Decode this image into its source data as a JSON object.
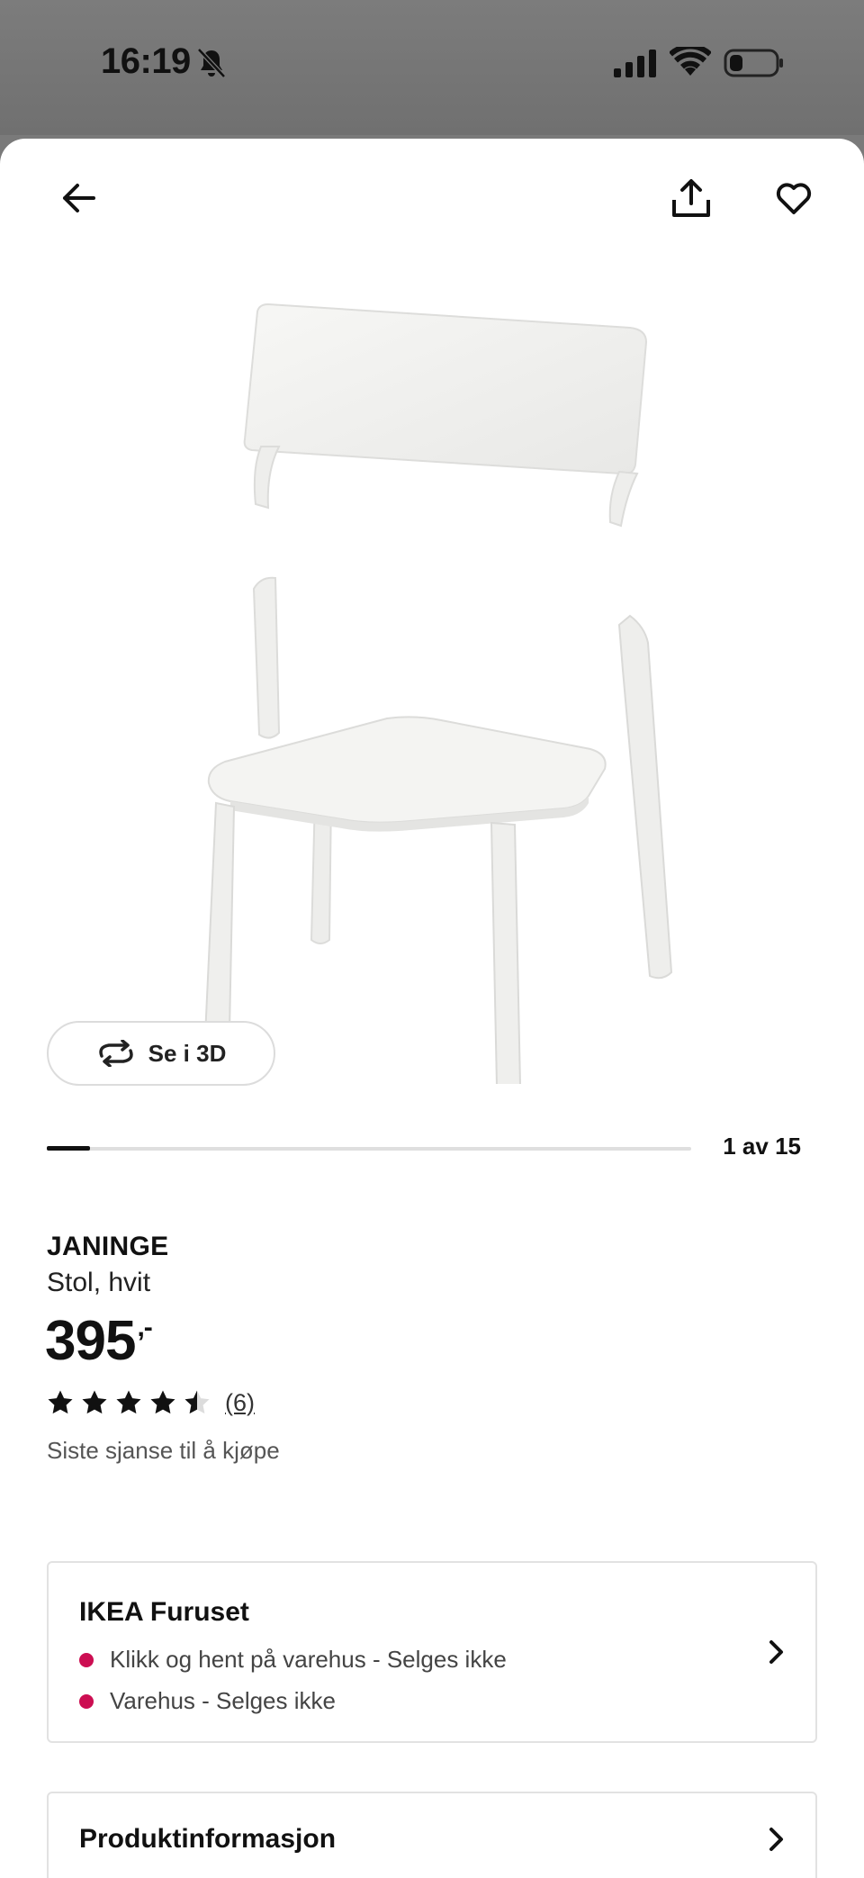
{
  "status_bar": {
    "time": "16:19"
  },
  "header": {
    "icons": [
      "arrow-left-icon",
      "share-icon",
      "heart-icon"
    ]
  },
  "gallery": {
    "view_3d_label": "Se i 3D",
    "counter": "1 av 15",
    "current": 1,
    "total": 15
  },
  "product": {
    "name": "JANINGE",
    "description": "Stol, hvit",
    "price": "395",
    "price_suffix": ",-",
    "rating": 4.5,
    "rating_max": 5,
    "review_count": "(6)",
    "sale_note": "Siste sjanse til å kjøpe"
  },
  "store": {
    "name": "IKEA Furuset",
    "lines": [
      "Klikk og hent på varehus - Selges ikke",
      "Varehus - Selges ikke"
    ],
    "status_color": "#cc0e52"
  },
  "info": {
    "title": "Produktinformasjon"
  }
}
